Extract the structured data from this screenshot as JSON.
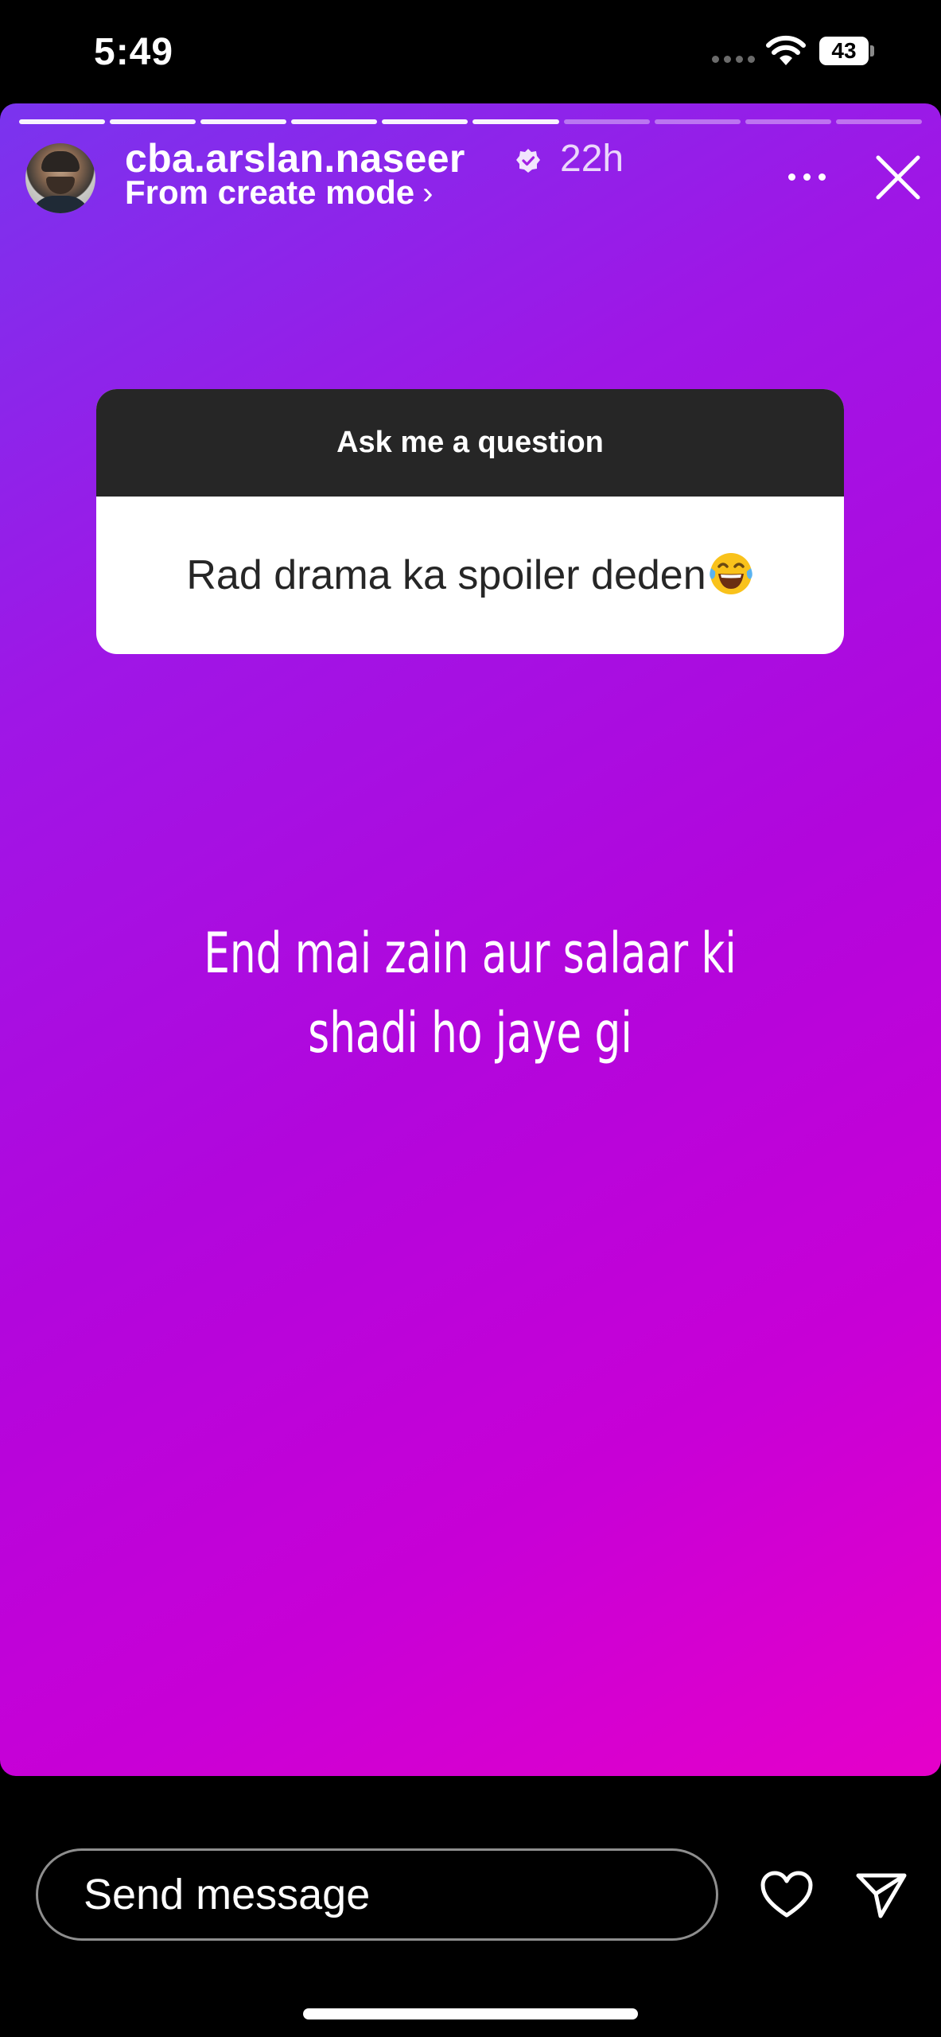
{
  "status_bar": {
    "time": "5:49",
    "battery_level": "43",
    "icons": [
      "signal-dots-icon",
      "wifi-icon",
      "battery-icon"
    ]
  },
  "story": {
    "background_colors": [
      "#7a34ee",
      "#b206dc",
      "#e500c9"
    ],
    "progress": {
      "segments": 10,
      "completed": 6
    },
    "header": {
      "username": "cba.arslan.naseer",
      "time_ago": "22h",
      "subtitle": "From create mode",
      "subtitle_chevron": "›",
      "icons": [
        "verified-badge-icon",
        "more-options-icon",
        "close-icon"
      ]
    },
    "question_sticker": {
      "prompt": "Ask me a question",
      "question": "Rad drama ka spoiler deden",
      "emoji": "face-with-tears-of-joy-icon"
    },
    "answer_text": "End mai zain aur salaar ki shadi ho jaye gi"
  },
  "footer": {
    "message_placeholder": "Send message",
    "icons": [
      "heart-icon",
      "send-icon"
    ]
  }
}
